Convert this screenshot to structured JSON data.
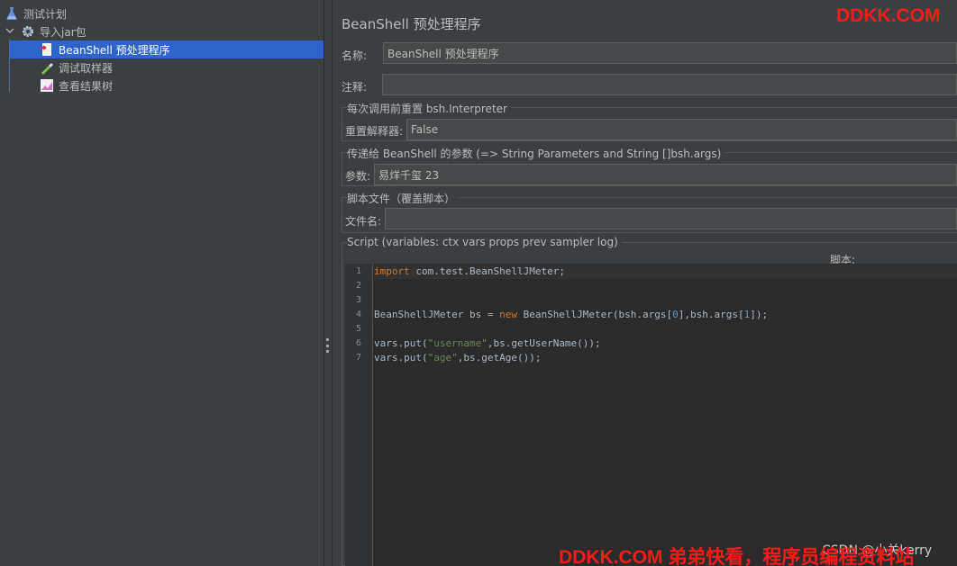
{
  "tree": {
    "items": [
      {
        "label": "测试计划",
        "icon": "flask-icon"
      },
      {
        "label": "导入jar包",
        "icon": "gear-icon"
      },
      {
        "label": "BeanShell 预处理程序",
        "icon": "script-document-icon"
      },
      {
        "label": "调试取样器",
        "icon": "pipette-icon"
      },
      {
        "label": "查看结果树",
        "icon": "chart-icon"
      }
    ]
  },
  "panel": {
    "title": "BeanShell 预处理程序",
    "name_label": "名称:",
    "name_value": "BeanShell 预处理程序",
    "comment_label": "注释:",
    "comment_value": "",
    "reset_section": "每次调用前重置 bsh.Interpreter",
    "reset_label": "重置解释器:",
    "reset_value": "False",
    "params_section": "传递给 BeanShell 的参数 (=> String Parameters and String []bsh.args)",
    "params_label": "参数:",
    "params_value": "易烊千玺 23",
    "file_section": "脚本文件（覆盖脚本）",
    "file_label": "文件名:",
    "file_value": "",
    "script_section": "Script (variables: ctx vars props prev sampler log)",
    "script_label": "脚本:"
  },
  "editor": {
    "line_numbers": [
      "1",
      "2",
      "3",
      "4",
      "5",
      "6",
      "7"
    ],
    "lines": [
      [
        {
          "t": "import",
          "c": "kw"
        },
        {
          "t": " com.test.BeanShellJMeter;",
          "c": ""
        }
      ],
      [],
      [],
      [
        {
          "t": "BeanShellJMeter bs = ",
          "c": ""
        },
        {
          "t": "new",
          "c": "kw"
        },
        {
          "t": " BeanShellJMeter(bsh.args[",
          "c": ""
        },
        {
          "t": "0",
          "c": "num"
        },
        {
          "t": "],bsh.args[",
          "c": ""
        },
        {
          "t": "1",
          "c": "num"
        },
        {
          "t": "]);",
          "c": ""
        }
      ],
      [],
      [
        {
          "t": "vars.put(",
          "c": ""
        },
        {
          "t": "\"username\"",
          "c": "str"
        },
        {
          "t": ",bs.getUserName());",
          "c": ""
        }
      ],
      [
        {
          "t": "vars.put(",
          "c": ""
        },
        {
          "t": "\"age\"",
          "c": "str"
        },
        {
          "t": ",bs.getAge());",
          "c": ""
        }
      ]
    ]
  },
  "watermarks": {
    "top": "DDKK.COM",
    "bottom": "DDKK.COM 弟弟快看，程序员编程资料站",
    "csdn": "CSDN @小关kerry"
  },
  "colors": {
    "selection": "#2f65ca",
    "keyword": "#cc7832",
    "string": "#6a8759",
    "number": "#6897bb",
    "watermark": "#ff1a1a"
  }
}
